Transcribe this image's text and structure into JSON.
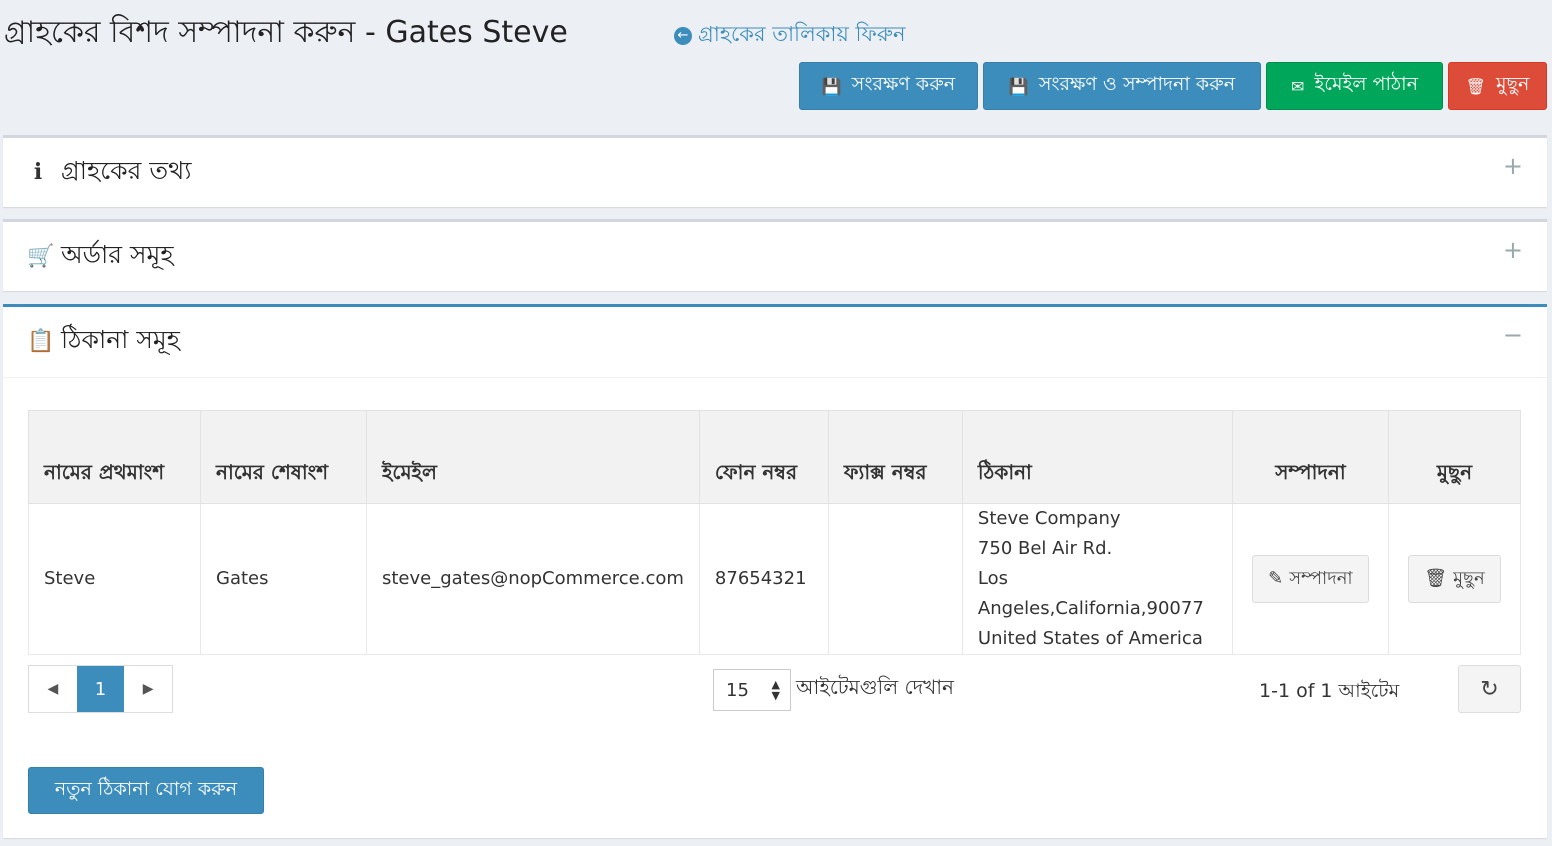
{
  "header": {
    "title": "গ্রাহকের বিশদ সম্পাদনা করুন - Gates Steve",
    "back_link": "গ্রাহকের তালিকায় ফিরুন"
  },
  "toolbar": {
    "save": "সংরক্ষণ করুন",
    "save_continue": "সংরক্ষণ ও সম্পাদনা করুন",
    "send_email": "ইমেইল পাঠান",
    "delete": "মুছুন"
  },
  "panels": {
    "customer_info": "গ্রাহকের তথ্য",
    "orders": "অর্ডার সমূহ",
    "addresses": "ঠিকানা সমূহ"
  },
  "addresses": {
    "columns": {
      "first_name": "নামের প্রথমাংশ",
      "last_name": "নামের শেষাংশ",
      "email": "ইমেইল",
      "phone": "ফোন নম্বর",
      "fax": "ফ্যাক্স নম্বর",
      "address": "ঠিকানা",
      "edit": "সম্পাদনা",
      "delete": "মুছুন"
    },
    "rows": [
      {
        "first_name": "Steve",
        "last_name": "Gates",
        "email": "steve_gates@nopCommerce.com",
        "phone": "87654321",
        "fax": "",
        "address_line1": "Steve Company",
        "address_line2": "750 Bel Air Rd.",
        "address_line3": "Los Angeles,California,90077",
        "address_line4": "United States of America",
        "edit_label": "সম্পাদনা",
        "delete_label": "মুছুন"
      }
    ],
    "pager": {
      "current_page": "1",
      "page_size": "15",
      "page_size_label": "আইটেমগুলি দেখান",
      "item_count": "1-1 of 1 আইটেম"
    },
    "add_button": "নতুন ঠিকানা যোগ করুন"
  },
  "colors": {
    "primary": "#3c8dbc",
    "success": "#00a65a",
    "danger": "#dd4b39",
    "background": "#ecf0f5"
  }
}
